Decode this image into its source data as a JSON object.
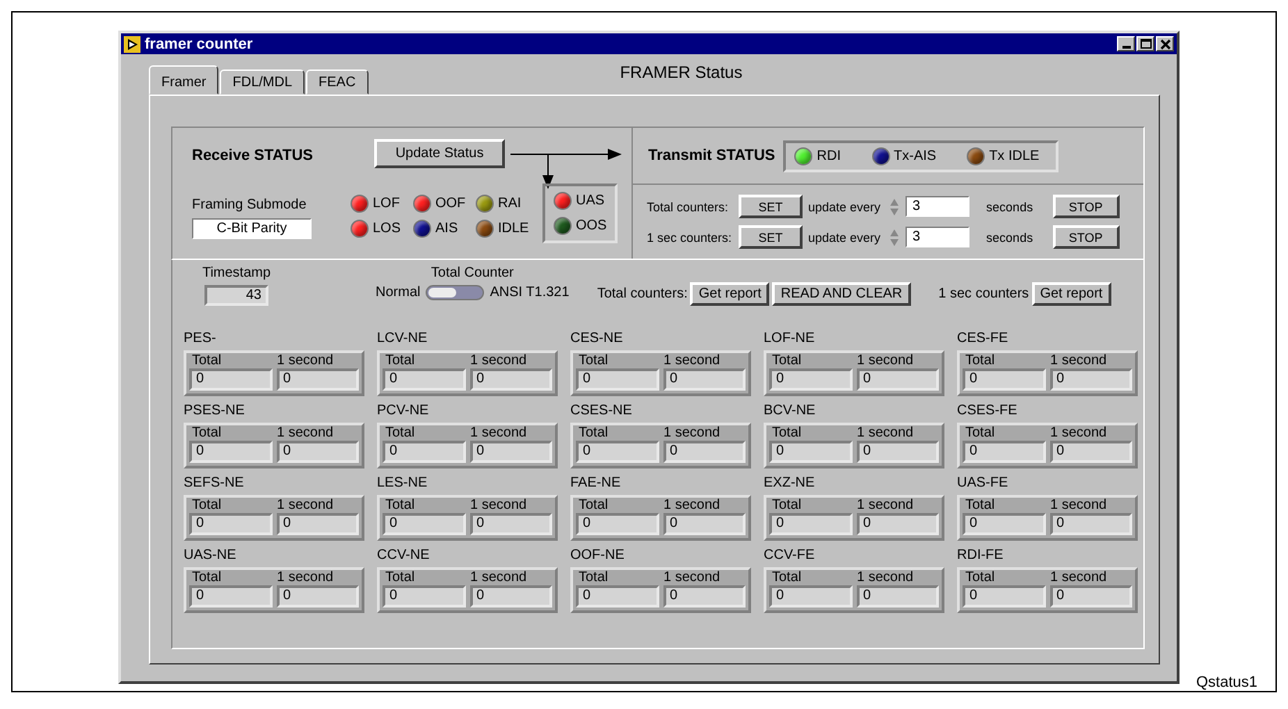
{
  "window": {
    "title": "framer counter"
  },
  "tabs": [
    {
      "label": "Framer",
      "selected": true
    },
    {
      "label": "FDL/MDL",
      "selected": false
    },
    {
      "label": "FEAC",
      "selected": false
    }
  ],
  "heading": "FRAMER Status",
  "receive": {
    "title": "Receive STATUS",
    "update_button": "Update Status",
    "submode_label": "Framing Submode",
    "submode_value": "C-Bit Parity",
    "lamps": [
      {
        "label": "LOF",
        "color": "#ff2020"
      },
      {
        "label": "OOF",
        "color": "#ff2020"
      },
      {
        "label": "RAI",
        "color": "#9a9a10"
      },
      {
        "label": "LOS",
        "color": "#ff2020"
      },
      {
        "label": "AIS",
        "color": "#101090"
      },
      {
        "label": "IDLE",
        "color": "#8a4a10"
      }
    ],
    "alarm_lamps": [
      {
        "label": "UAS",
        "color": "#ff2020"
      },
      {
        "label": "OOS",
        "color": "#1e5a1e"
      }
    ]
  },
  "transmit": {
    "title": "Transmit STATUS",
    "lamps": [
      {
        "label": "RDI",
        "color": "#50f030"
      },
      {
        "label": "Tx-AIS",
        "color": "#101090"
      },
      {
        "label": "Tx IDLE",
        "color": "#8a4a10"
      }
    ]
  },
  "update_rows": [
    {
      "label": "Total counters:",
      "button": "SET",
      "update_label": "update every",
      "value": "3",
      "unit": "seconds",
      "stop": "STOP"
    },
    {
      "label": "1 sec counters:",
      "button": "SET",
      "update_label": "update every",
      "value": "3",
      "unit": "seconds",
      "stop": "STOP"
    }
  ],
  "timestamp": {
    "label": "Timestamp",
    "value": "43"
  },
  "total_counter": {
    "label": "Total Counter",
    "left": "Normal",
    "right": "ANSI T1.321",
    "on": false
  },
  "reports": [
    {
      "label": "Total counters:",
      "buttons": [
        "Get report",
        "READ AND CLEAR"
      ]
    },
    {
      "label": "1 sec counters",
      "buttons": [
        "Get report"
      ]
    }
  ],
  "counters": [
    {
      "name": "PES-",
      "col_1": "Total",
      "col_2": "1 second",
      "total": "0",
      "one_second": "0"
    },
    {
      "name": "LCV-NE",
      "col_1": "Total",
      "col_2": "1 second",
      "total": "0",
      "one_second": "0"
    },
    {
      "name": "CES-NE",
      "col_1": "Total",
      "col_2": "1 second",
      "total": "0",
      "one_second": "0"
    },
    {
      "name": "LOF-NE",
      "col_1": "Total",
      "col_2": "1 second",
      "total": "0",
      "one_second": "0"
    },
    {
      "name": "CES-FE",
      "col_1": "Total",
      "col_2": "1 second",
      "total": "0",
      "one_second": "0"
    },
    {
      "name": "PSES-NE",
      "col_1": "Total",
      "col_2": "1 second",
      "total": "0",
      "one_second": "0"
    },
    {
      "name": "PCV-NE",
      "col_1": "Total",
      "col_2": "1 second",
      "total": "0",
      "one_second": "0"
    },
    {
      "name": "CSES-NE",
      "col_1": "Total",
      "col_2": "1 second",
      "total": "0",
      "one_second": "0"
    },
    {
      "name": "BCV-NE",
      "col_1": "Total",
      "col_2": "1 second",
      "total": "0",
      "one_second": "0"
    },
    {
      "name": "CSES-FE",
      "col_1": "Total",
      "col_2": "1 second",
      "total": "0",
      "one_second": "0"
    },
    {
      "name": "SEFS-NE",
      "col_1": "Total",
      "col_2": "1 second",
      "total": "0",
      "one_second": "0"
    },
    {
      "name": "LES-NE",
      "col_1": "Total",
      "col_2": "1 second",
      "total": "0",
      "one_second": "0"
    },
    {
      "name": "FAE-NE",
      "col_1": "Total",
      "col_2": "1 second",
      "total": "0",
      "one_second": "0"
    },
    {
      "name": "EXZ-NE",
      "col_1": "Total",
      "col_2": "1 second",
      "total": "0",
      "one_second": "0"
    },
    {
      "name": "UAS-FE",
      "col_1": "Total",
      "col_2": "1 second",
      "total": "0",
      "one_second": "0"
    },
    {
      "name": "UAS-NE",
      "col_1": "Total",
      "col_2": "1 second",
      "total": "0",
      "one_second": "0"
    },
    {
      "name": "CCV-NE",
      "col_1": "Total",
      "col_2": "1 second",
      "total": "0",
      "one_second": "0"
    },
    {
      "name": "OOF-NE",
      "col_1": "Total",
      "col_2": "1 second",
      "total": "0",
      "one_second": "0"
    },
    {
      "name": "CCV-FE",
      "col_1": "Total",
      "col_2": "1 second",
      "total": "0",
      "one_second": "0"
    },
    {
      "name": "RDI-FE",
      "col_1": "Total",
      "col_2": "1 second",
      "total": "0",
      "one_second": "0"
    }
  ],
  "caption": "Qstatus1"
}
